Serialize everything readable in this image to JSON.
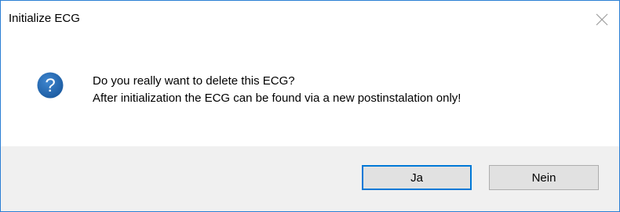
{
  "dialog": {
    "title": "Initialize ECG",
    "close_icon": "close-icon",
    "icon": "question-icon",
    "message_line1": "Do you really want to delete this ECG?",
    "message_line2": "After initialization the ECG can be found via a new postinstalation only!",
    "buttons": {
      "yes_label": "Ja",
      "no_label": "Nein"
    }
  },
  "colors": {
    "frame_border": "#2b7fd4",
    "icon_blue": "#1e5fa8",
    "footer_bg": "#f0f0f0",
    "default_button_border": "#0078d7"
  }
}
